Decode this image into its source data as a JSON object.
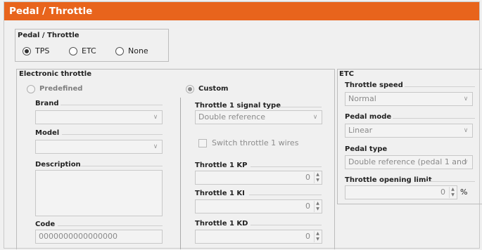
{
  "title": "Pedal / Throttle",
  "pedal_group": {
    "title": "Pedal / Throttle",
    "options": [
      {
        "label": "TPS",
        "checked": true
      },
      {
        "label": "ETC",
        "checked": false
      },
      {
        "label": "None",
        "checked": false
      }
    ]
  },
  "electronic_throttle": {
    "title": "Electronic throttle",
    "predefined_label": "Predefined",
    "custom_label": "Custom",
    "brand_label": "Brand",
    "brand_value": "",
    "model_label": "Model",
    "model_value": "",
    "description_label": "Description",
    "code_label": "Code",
    "code_value": "0000000000000000",
    "signal_type_label": "Throttle 1 signal type",
    "signal_type_value": "Double reference",
    "switch_wires_label": "Switch throttle 1 wires",
    "kp_label": "Throttle 1 KP",
    "kp_value": "0",
    "ki_label": "Throttle 1 KI",
    "ki_value": "0",
    "kd_label": "Throttle 1 KD",
    "kd_value": "0"
  },
  "etc": {
    "title": "ETC",
    "speed_label": "Throttle speed",
    "speed_value": "Normal",
    "pedal_mode_label": "Pedal mode",
    "pedal_mode_value": "Linear",
    "pedal_type_label": "Pedal type",
    "pedal_type_value": "Double reference (pedal 1 and",
    "opening_limit_label": "Throttle opening limit",
    "opening_limit_value": "0",
    "opening_limit_unit": "%"
  },
  "icons": {
    "dropdown": "chevron-down-icon",
    "spinner": "spinner-arrows-icon"
  },
  "colors": {
    "header": "#e8641c",
    "background": "#f0f0f0"
  }
}
